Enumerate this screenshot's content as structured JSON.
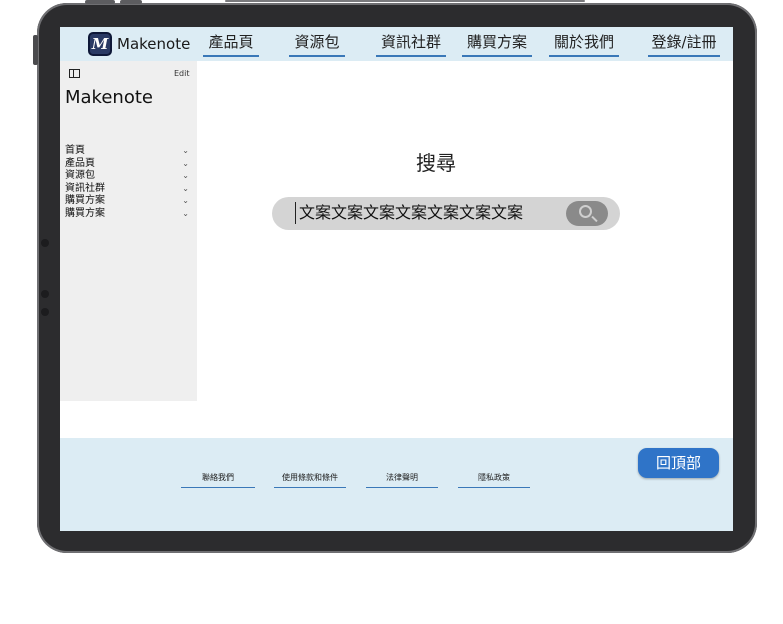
{
  "brand": {
    "logo_letter": "M",
    "name": "Makenote"
  },
  "nav": {
    "links": [
      "產品頁",
      "資源包",
      "資訊社群",
      "購買方案",
      "關於我們",
      "登錄/註冊"
    ]
  },
  "sidebar": {
    "edit_label": "Edit",
    "title": "Makenote",
    "items": [
      {
        "label": "首頁",
        "chevron": "⌄"
      },
      {
        "label": "產品頁",
        "chevron": "⌄"
      },
      {
        "label": "資源包",
        "chevron": "⌄"
      },
      {
        "label": "資訊社群",
        "chevron": "⌄"
      },
      {
        "label": "購買方案",
        "chevron": "⌄"
      },
      {
        "label": "購買方案",
        "chevron": "⌄"
      }
    ]
  },
  "search": {
    "title": "搜尋",
    "query": "文案文案文案文案文案文案文案"
  },
  "footer": {
    "links": [
      "聯絡我們",
      "使用條款和條件",
      "法律聲明",
      "隱私政策"
    ],
    "back_to_top": "回頂部"
  },
  "colors": {
    "nav_bg": "#dcecf4",
    "accent": "#3a78b8",
    "button": "#2f74c8",
    "sidebar_bg": "#efefef",
    "device_frame": "#2c2c2e"
  },
  "icons": [
    "sidebar-toggle-icon",
    "search-icon",
    "chevron-down-icon"
  ]
}
